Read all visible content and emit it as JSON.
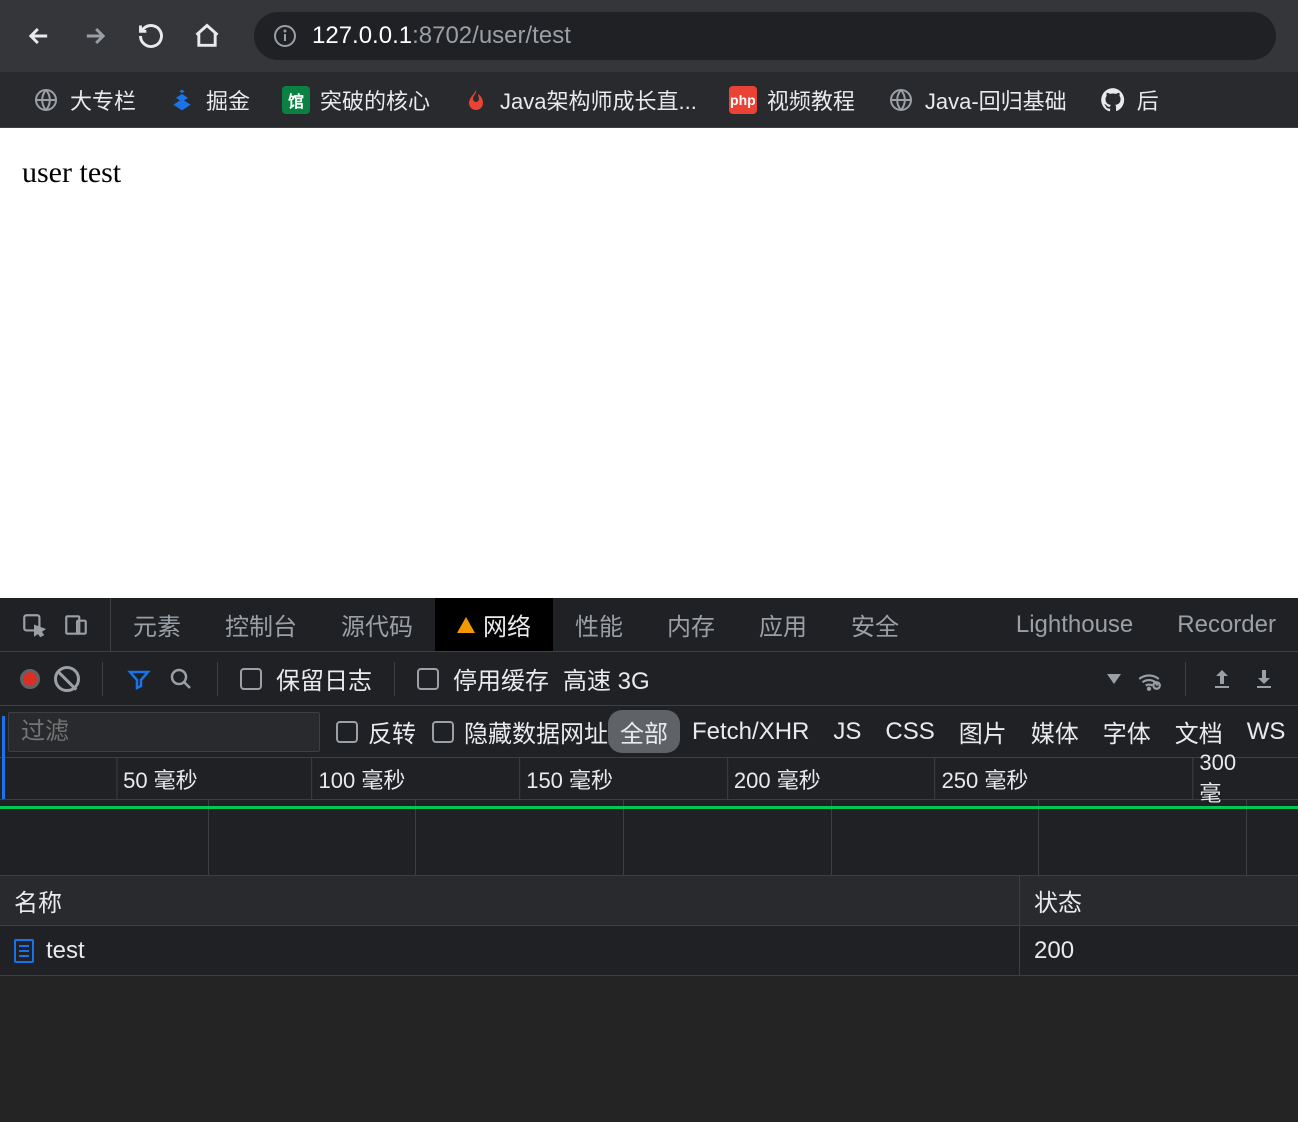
{
  "browser": {
    "url_host": "127.0.0.1",
    "url_port_path": ":8702/user/test"
  },
  "bookmarks": [
    {
      "label": "大专栏"
    },
    {
      "label": "掘金"
    },
    {
      "label": "突破的核心"
    },
    {
      "label": "Java架构师成长直..."
    },
    {
      "label": "视频教程"
    },
    {
      "label": "Java-回归基础"
    },
    {
      "label": "后"
    }
  ],
  "page": {
    "body_text": "user test"
  },
  "devtools": {
    "tabs": {
      "elements": "元素",
      "console": "控制台",
      "sources": "源代码",
      "network": "网络",
      "performance": "性能",
      "memory": "内存",
      "application": "应用",
      "security": "安全",
      "lighthouse": "Lighthouse",
      "recorder": "Recorder"
    },
    "network_toolbar": {
      "preserve_log": "保留日志",
      "disable_cache": "停用缓存",
      "throttling": "高速 3G"
    },
    "filter": {
      "placeholder": "过滤",
      "invert": "反转",
      "hide_data_urls": "隐藏数据网址",
      "types": [
        "全部",
        "Fetch/XHR",
        "JS",
        "CSS",
        "图片",
        "媒体",
        "字体",
        "文档",
        "WS"
      ]
    },
    "timeline_ticks": [
      "50 毫秒",
      "100 毫秒",
      "150 毫秒",
      "200 毫秒",
      "250 毫秒",
      "300 毫"
    ],
    "table": {
      "headers": {
        "name": "名称",
        "status": "状态"
      },
      "rows": [
        {
          "name": "test",
          "status": "200"
        }
      ]
    }
  }
}
